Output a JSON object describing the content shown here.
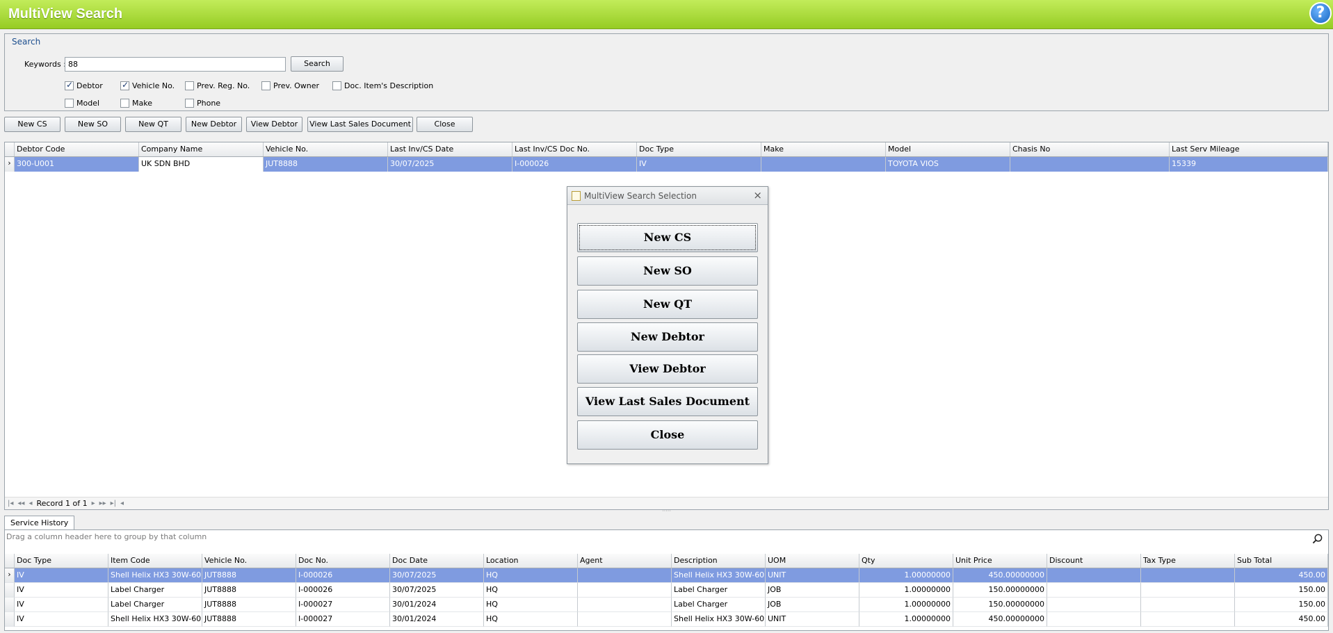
{
  "window": {
    "title": "MultiView Search",
    "help_icon": "help-icon"
  },
  "search": {
    "group_caption": "Search",
    "keywords_label": "Keywords :",
    "keywords_value": "88",
    "search_button": "Search",
    "checkboxes": [
      {
        "label": "Debtor",
        "checked": true
      },
      {
        "label": "Vehicle No.",
        "checked": true
      },
      {
        "label": "Prev. Reg. No.",
        "checked": false
      },
      {
        "label": "Prev. Owner",
        "checked": false
      },
      {
        "label": "Doc. Item's Description",
        "checked": false
      },
      {
        "label": "Model",
        "checked": false
      },
      {
        "label": "Make",
        "checked": false
      },
      {
        "label": "Phone",
        "checked": false
      }
    ]
  },
  "actions": {
    "new_cs": "New CS",
    "new_so": "New SO",
    "new_qt": "New QT",
    "new_debtor": "New Debtor",
    "view_debtor": "View Debtor",
    "view_last_sales": "View Last Sales Document",
    "close": "Close"
  },
  "main_grid": {
    "columns": [
      "Debtor Code",
      "Company Name",
      "Vehicle No.",
      "Last Inv/CS Date",
      "Last Inv/CS Doc No.",
      "Doc Type",
      "Make",
      "Model",
      "Chasis No",
      "Last Serv Mileage"
    ],
    "rows": [
      [
        "300-U001",
        "UK SDN BHD",
        "JUT8888",
        "30/07/2025",
        "I-000026",
        "IV",
        "",
        "TOYOTA VIOS",
        "",
        "15339"
      ]
    ],
    "record_text": "Record 1 of 1"
  },
  "dialog": {
    "title": "MultiView Search Selection",
    "buttons": [
      "New CS",
      "New SO",
      "New QT",
      "New Debtor",
      "View Debtor",
      "View Last Sales Document",
      "Close"
    ]
  },
  "history": {
    "tab_label": "Service History",
    "group_hint": "Drag a column header here to group by that column",
    "columns": [
      "Doc Type",
      "Item Code",
      "Vehicle No.",
      "Doc No.",
      "Doc Date",
      "Location",
      "Agent",
      "Description",
      "UOM",
      "Qty",
      "Unit Price",
      "Discount",
      "Tax Type",
      "Sub Total"
    ],
    "rows": [
      [
        "IV",
        "Shell Helix HX3 30W-60",
        "JUT8888",
        "I-000026",
        "30/07/2025",
        "HQ",
        "",
        "Shell Helix HX3 30W-60",
        "UNIT",
        "1.00000000",
        "450.00000000",
        "",
        "",
        "450.00"
      ],
      [
        "IV",
        "Label Charger",
        "JUT8888",
        "I-000026",
        "30/07/2025",
        "HQ",
        "",
        "Label Charger",
        "JOB",
        "1.00000000",
        "150.00000000",
        "",
        "",
        "150.00"
      ],
      [
        "IV",
        "Label Charger",
        "JUT8888",
        "I-000027",
        "30/01/2024",
        "HQ",
        "",
        "Label Charger",
        "JOB",
        "1.00000000",
        "150.00000000",
        "",
        "",
        "150.00"
      ],
      [
        "IV",
        "Shell Helix HX3 30W-60",
        "JUT8888",
        "I-000027",
        "30/01/2024",
        "HQ",
        "",
        "Shell Helix HX3 30W-60",
        "UNIT",
        "1.00000000",
        "450.00000000",
        "",
        "",
        "450.00"
      ]
    ]
  }
}
